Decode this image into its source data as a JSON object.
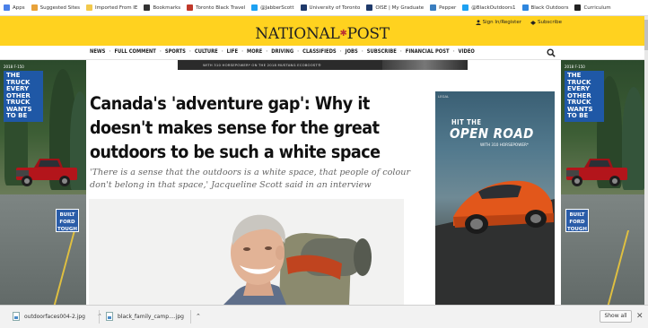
{
  "browser": {
    "bookmarks": [
      {
        "label": "Apps",
        "icon": "apps-grid-icon",
        "color": "#4a80e8"
      },
      {
        "label": "Suggested Sites",
        "icon": "suggested-sites-icon",
        "color": "#e8a23a"
      },
      {
        "label": "Imported From IE",
        "icon": "folder-icon",
        "color": "#f2c94c"
      },
      {
        "label": "Bookmarks",
        "icon": "star-icon",
        "color": "#333333"
      },
      {
        "label": "Toronto Black Travel",
        "icon": "toronto-icon",
        "color": "#c0392b"
      },
      {
        "label": "@JabberScott",
        "icon": "twitter-icon",
        "color": "#1da1f2"
      },
      {
        "label": "University of Toronto",
        "icon": "university-icon",
        "color": "#1f3a6b"
      },
      {
        "label": "OISE | My Graduate",
        "icon": "oise-icon",
        "color": "#1f3a6b"
      },
      {
        "label": "Pepper",
        "icon": "pepper-icon",
        "color": "#3a7ec0"
      },
      {
        "label": "@BlackOutdoors1",
        "icon": "twitter-icon",
        "color": "#1da1f2"
      },
      {
        "label": "Black Outdoors",
        "icon": "globe-icon",
        "color": "#2e86de"
      },
      {
        "label": "Curriculum",
        "icon": "curriculum-icon",
        "color": "#222222"
      }
    ]
  },
  "site": {
    "logo_text": "NATIONAL",
    "logo_star": "✱",
    "logo_text_2": "POST",
    "sign_in": "Sign In/Register",
    "subscribe": "Subscribe",
    "header_color": "#ffd21f",
    "nav": [
      "NEWS",
      "FULL COMMENT",
      "SPORTS",
      "CULTURE",
      "LIFE",
      "MORE",
      "DRIVING",
      "CLASSIFIEDS",
      "JOBS",
      "SUBSCRIBE",
      "FINANCIAL POST",
      "VIDEO"
    ]
  },
  "ads": {
    "top_strip_tagline": "WITH 310 HORSEPOWER* ON THE 2018 MUSTANG ECOBOOST®",
    "side_year": "2018 F-150",
    "side_message": "THE TRUCK EVERY OTHER TRUCK WANTS TO BE",
    "side_badge": "BUILT FORD TOUGH",
    "right_label": "LEGAL",
    "right_hit": "HIT THE",
    "right_open": "OPEN ROAD",
    "right_sub": "WITH 310 HORSEPOWER*"
  },
  "article": {
    "headline": "Canada's 'adventure gap': Why it doesn't makes sense for the great outdoors to be such a white space",
    "dek": "'There is a sense that the outdoors is a white space, that people of colour don't belong in that space,' Jacqueline Scott said in an interview"
  },
  "downloads": {
    "items": [
      "outdoorfaces004-2.jpg",
      "black_family_camp....jpg"
    ],
    "show_all": "Show all",
    "close": "✕"
  }
}
